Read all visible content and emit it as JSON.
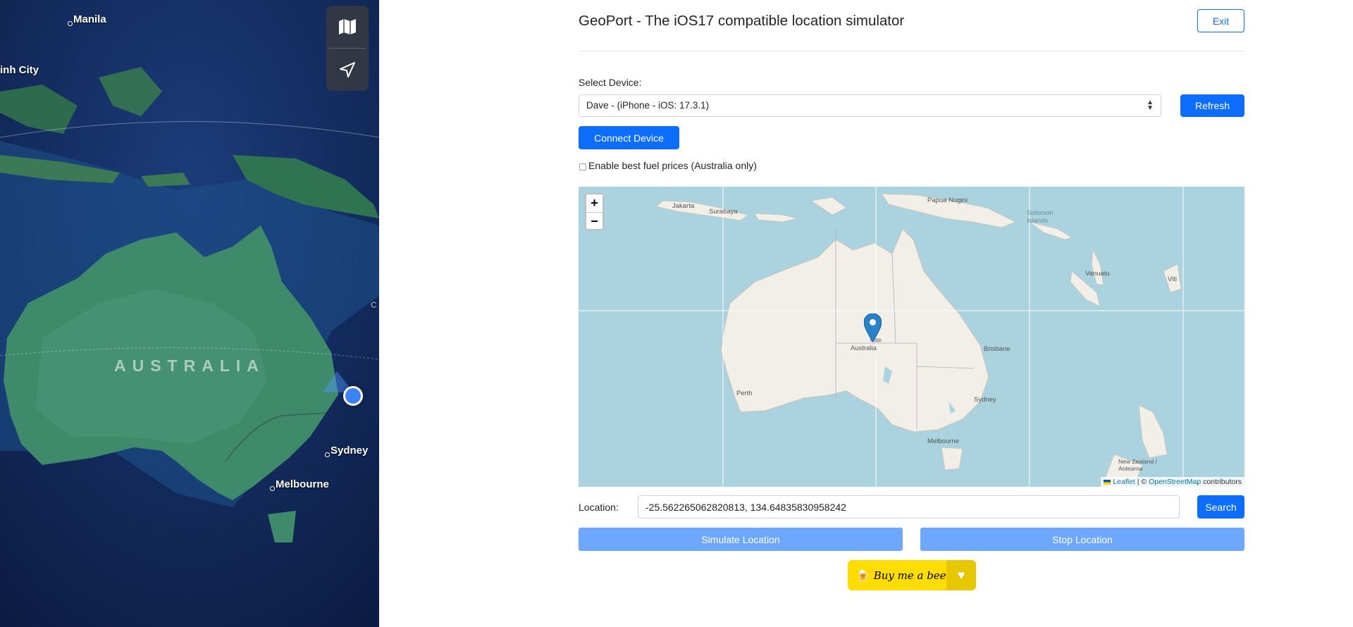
{
  "satellite_map": {
    "cities": [
      {
        "name": "Manila"
      },
      {
        "name": "inh City"
      },
      {
        "name": "Sydney"
      },
      {
        "name": "Melbourne"
      }
    ],
    "country_label": "AUSTRALIA",
    "controls": [
      {
        "icon": "map-icon"
      },
      {
        "icon": "location-arrow-icon"
      }
    ],
    "edge_letter": "C"
  },
  "app": {
    "title": "GeoPort - The iOS17 compatible location simulator",
    "exit_label": "Exit",
    "select_device_label": "Select Device:",
    "device_selected": "Dave - (iPhone - iOS: 17.3.1)",
    "refresh_label": "Refresh",
    "connect_label": "Connect Device",
    "fuel_checkbox_label": "Enable best fuel prices (Australia only)",
    "fuel_checkbox_checked": false,
    "map": {
      "zoom_in": "+",
      "zoom_out": "−",
      "labels": {
        "jakarta": "Jakarta",
        "surabaya": "Surabaya",
        "papua": "Papua Nugini",
        "solomon": "Solomon Islands",
        "vanuatu": "Vanuatu",
        "australia": "Australia",
        "brisbane": "Brisbane",
        "perth": "Perth",
        "sydney": "Sydney",
        "melbourne": "Melbourne",
        "nz": "New Zealand / Aotearoa",
        "fiji": "Viti"
      },
      "attribution_leaflet": "Leaflet",
      "attribution_sep": " | © ",
      "attribution_osm": "OpenStreetMap",
      "attribution_contrib": " contributors"
    },
    "location_label": "Location:",
    "location_value": "-25.562265062820813, 134.64835830958242",
    "search_label": "Search",
    "simulate_label": "Simulate Location",
    "stop_label": "Stop Location",
    "beer_label": "Buy me a beer",
    "beer_emoji": "🍺"
  }
}
